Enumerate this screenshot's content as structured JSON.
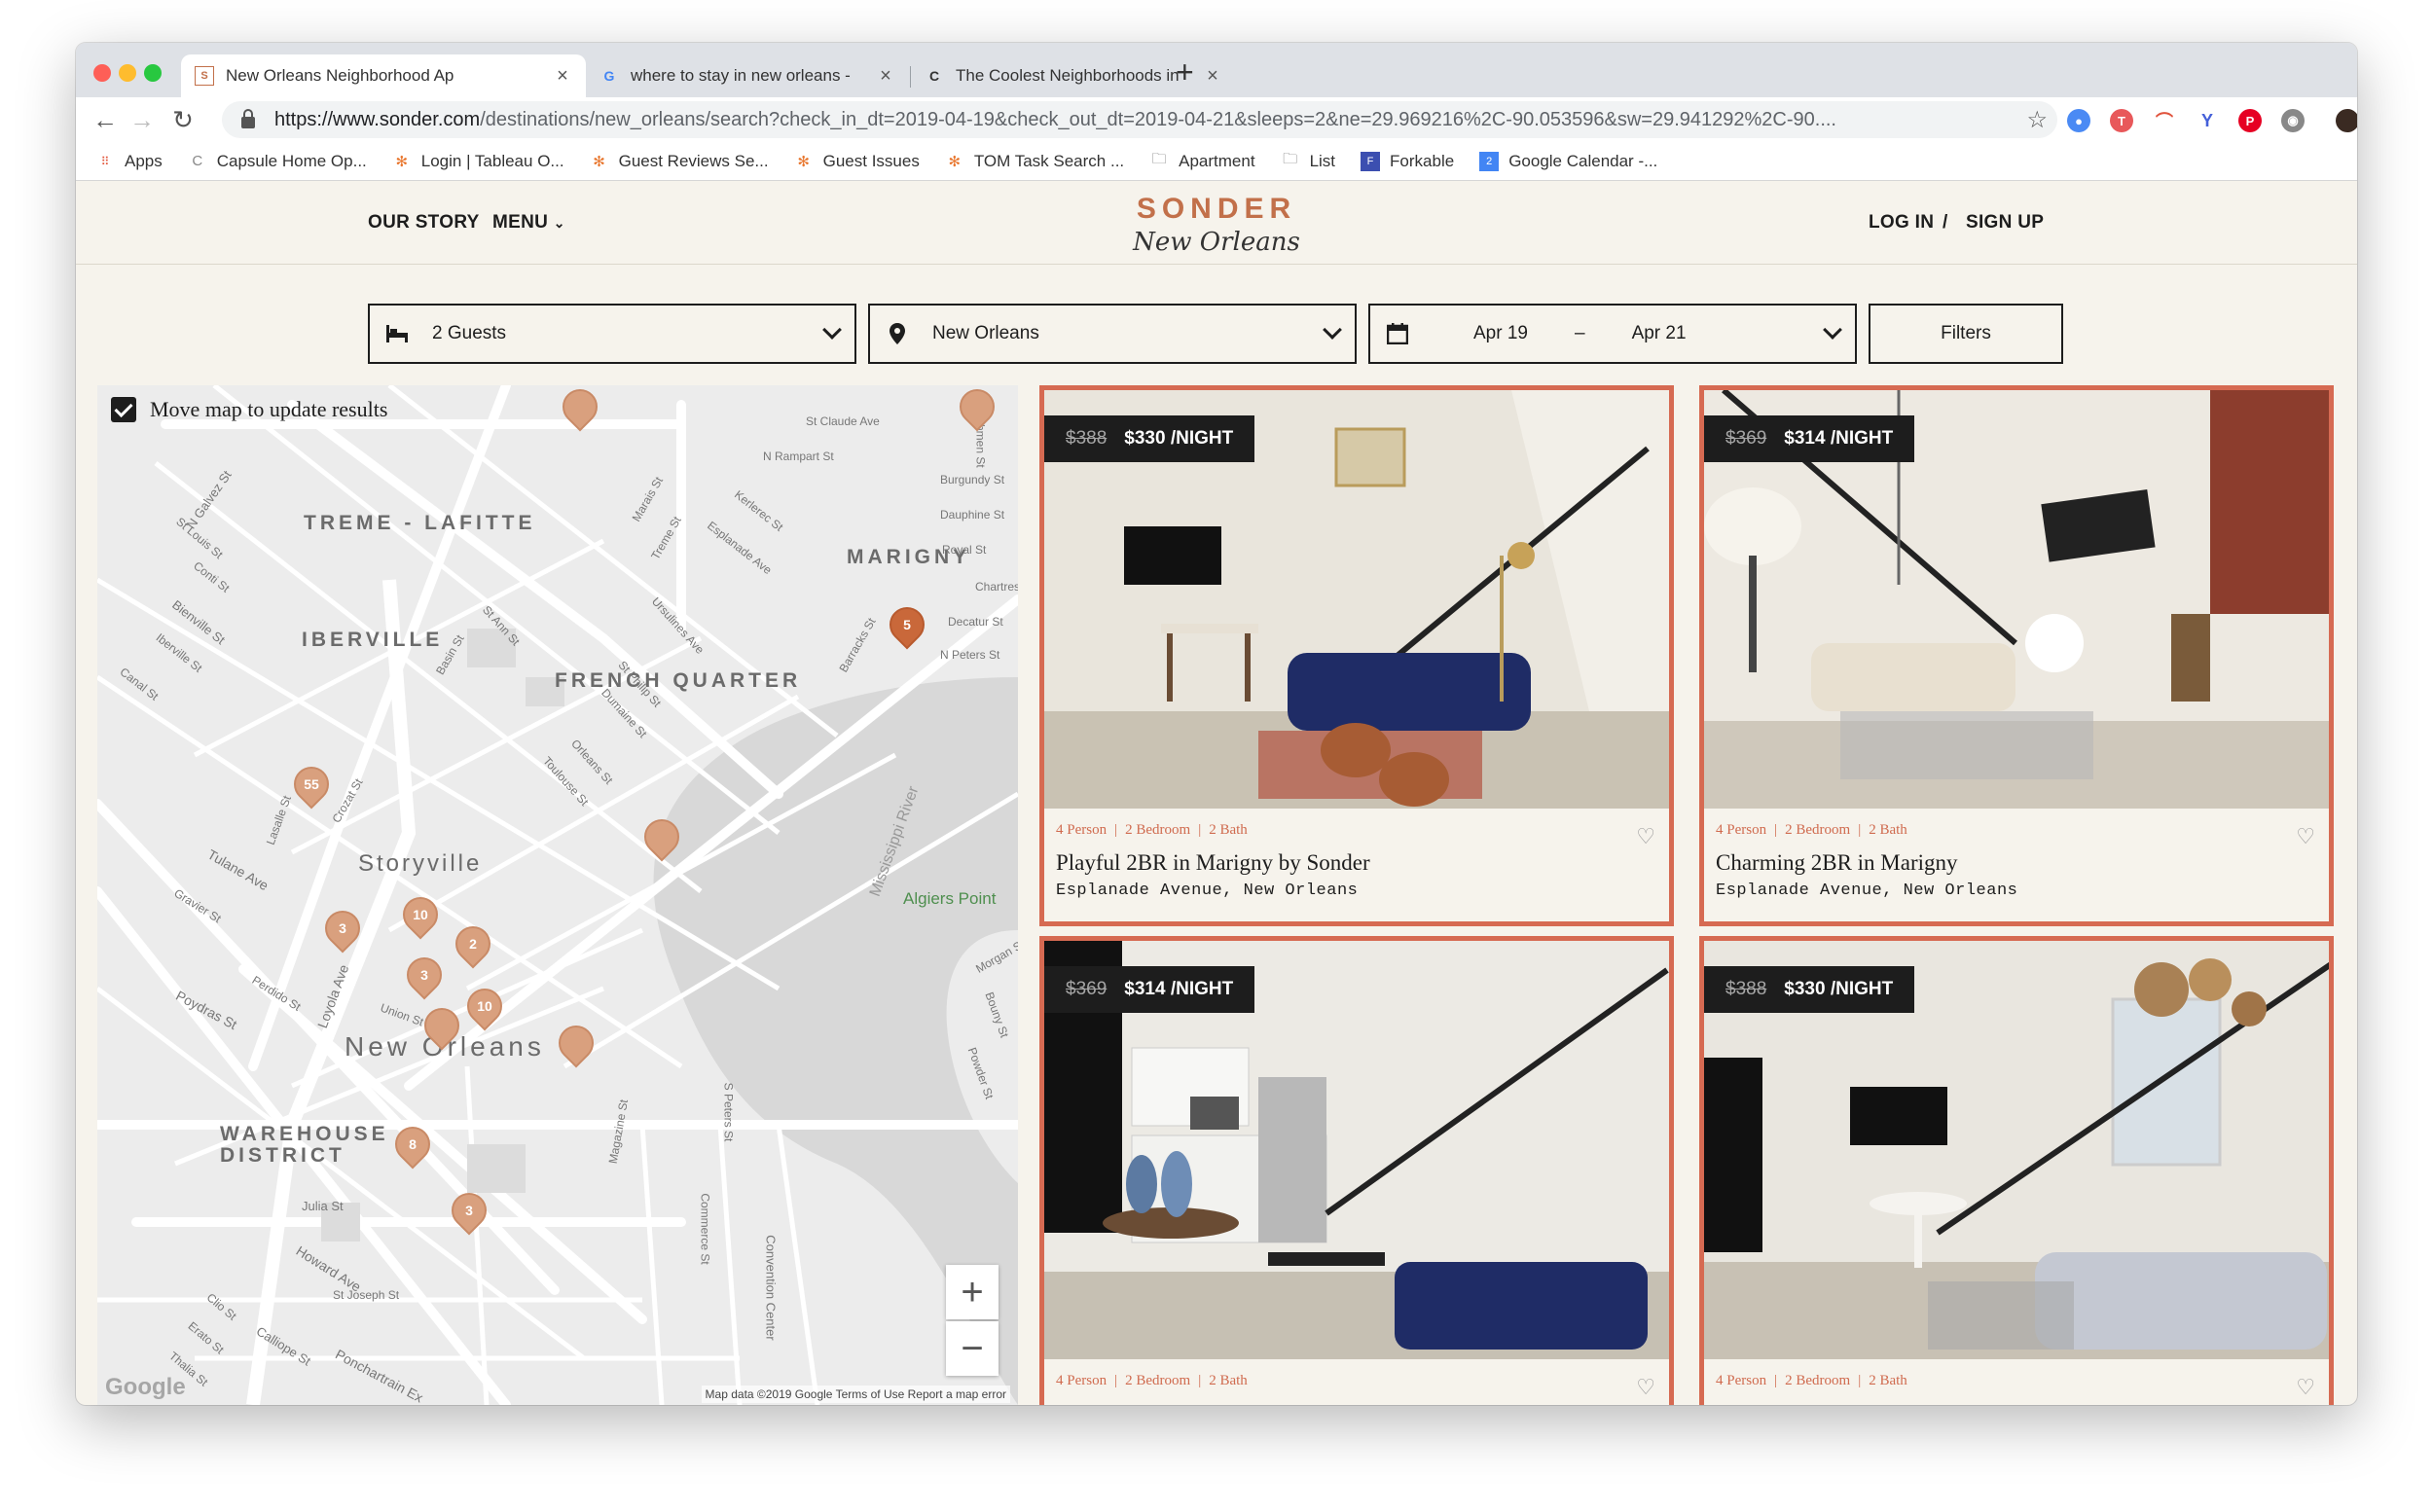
{
  "browser": {
    "tabs": [
      {
        "title": "New Orleans Neighborhood Ap",
        "icon": "sonder-favicon"
      },
      {
        "title": "where to stay in new orleans -",
        "icon": "google-favicon"
      },
      {
        "title": "The Coolest Neighborhoods in",
        "icon": "culture-trip-favicon"
      }
    ],
    "url_host": "https://www.sonder.com",
    "url_path": "/destinations/new_orleans/search?check_in_dt=2019-04-19&check_out_dt=2019-04-21&sleeps=2&ne=29.969216%2C-90.053596&sw=29.941292%2C-90....",
    "bookmarks": [
      {
        "label": "Apps",
        "icon": "apps-grid-icon"
      },
      {
        "label": "Capsule Home Op...",
        "icon": "capsule-icon"
      },
      {
        "label": "Login | Tableau O...",
        "icon": "tableau-icon"
      },
      {
        "label": "Guest Reviews Se...",
        "icon": "tableau-icon"
      },
      {
        "label": "Guest Issues",
        "icon": "tableau-icon"
      },
      {
        "label": "TOM Task Search ...",
        "icon": "tableau-icon"
      },
      {
        "label": "Apartment",
        "icon": "folder-icon"
      },
      {
        "label": "List",
        "icon": "folder-icon"
      },
      {
        "label": "Forkable",
        "icon": "forkable-icon"
      },
      {
        "label": "Google Calendar -...",
        "icon": "calendar-icon"
      }
    ]
  },
  "header": {
    "our_story": "OUR STORY",
    "menu": "MENU",
    "brand": "SONDER",
    "city": "New Orleans",
    "log_in": "LOG IN",
    "slash": "/",
    "sign_up": "SIGN UP"
  },
  "search": {
    "guests": "2 Guests",
    "location": "New Orleans",
    "check_in": "Apr 19",
    "dash": "–",
    "check_out": "Apr 21",
    "filters": "Filters"
  },
  "map": {
    "move_map_label": "Move map to update results",
    "districts": [
      "TREME - LAFITTE",
      "MARIGNY",
      "IBERVILLE",
      "FRENCH QUARTER",
      "Storyville",
      "New Orleans",
      "WAREHOUSE",
      "DISTRICT"
    ],
    "place_label": "Algiers Point",
    "river_label": "Mississippi River",
    "pins": [
      "5",
      "55",
      "3",
      "10",
      "2",
      "3",
      "10",
      "8",
      "3"
    ],
    "footer": "Map data ©2019 Google   Terms of Use   Report a map error",
    "google_mark": "Google",
    "streets": [
      "St Claude Ave",
      "N Rampart St",
      "Esplanade Ave",
      "Burgundy St",
      "Dauphine St",
      "Royal St",
      "Chartres St",
      "Decatur St",
      "N Peters St",
      "Canal St",
      "Tulane Ave",
      "Poydras St",
      "Howard Ave",
      "Julia St",
      "Basin St",
      "Loyola Ave",
      "Union St",
      "Perdido St",
      "Gravier St",
      "Bienville St",
      "Iberville St",
      "Conti St",
      "St Louis St",
      "N Galvez St",
      "Commerce St",
      "S Peters St",
      "Convention Center",
      "Calliope St",
      "Erato St",
      "Thalia St",
      "Clio St",
      "St Joseph St",
      "Ponchartrain Ex",
      "Magazine St",
      "Frenchmen St",
      "Kerlerec St",
      "Marais St",
      "Treme St",
      "Ursulines Ave",
      "Barracks St",
      "St Philip St",
      "Dumaine St",
      "St Ann St",
      "Orleans St",
      "Toulouse St",
      "Crozat St",
      "Lasalle St",
      "Morgan St",
      "Bouny St",
      "Powder St"
    ]
  },
  "listings": [
    {
      "old_price": "$388",
      "price": "$330 /NIGHT",
      "persons": "4 Person",
      "bedrooms": "2 Bedroom",
      "baths": "2 Bath",
      "title": "Playful 2BR in Marigny by Sonder",
      "address": "Esplanade Avenue, New Orleans"
    },
    {
      "old_price": "$369",
      "price": "$314 /NIGHT",
      "persons": "4 Person",
      "bedrooms": "2 Bedroom",
      "baths": "2 Bath",
      "title": "Charming 2BR in Marigny",
      "address": "Esplanade Avenue, New Orleans"
    },
    {
      "old_price": "$369",
      "price": "$314 /NIGHT",
      "persons": "4 Person",
      "bedrooms": "2 Bedroom",
      "baths": "2 Bath"
    },
    {
      "old_price": "$388",
      "price": "$330 /NIGHT",
      "persons": "4 Person",
      "bedrooms": "2 Bedroom",
      "baths": "2 Bath"
    }
  ],
  "colors": {
    "accent": "#d66a52",
    "brand": "#c2704a",
    "background": "#f6f3ec",
    "pin": "#d9a07e"
  }
}
